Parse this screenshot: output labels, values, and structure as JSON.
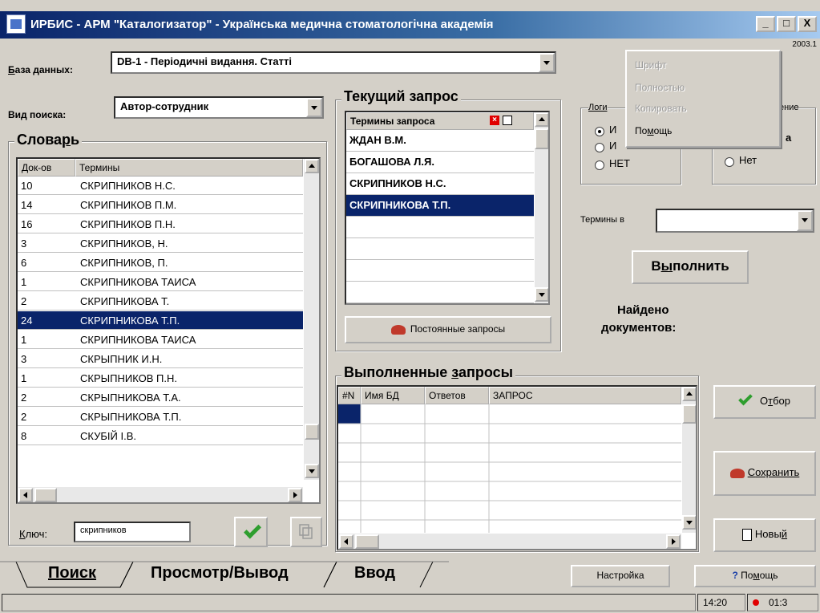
{
  "window": {
    "title": "ИРБИС - АРМ \"Каталогизатор\" - Українська медична стоматологічна академія",
    "version_text": "2003.1",
    "controls": [
      "_",
      "□",
      "X"
    ]
  },
  "database": {
    "label_prefix": "Б",
    "label_rest": "аза данных:",
    "value": "DB-1 - Періодичні видання. Статті"
  },
  "search_kind": {
    "label": "Вид поиска:",
    "value": "Автор-сотрудник"
  },
  "dictionary": {
    "title_pre": "Слова",
    "title_u": "р",
    "title_post": "ь",
    "col_docs": "Док-ов",
    "col_terms": "Термины",
    "rows": [
      {
        "docs": "10",
        "term": "СКРИПНИКОВ Н.С.",
        "selected": false
      },
      {
        "docs": "14",
        "term": "СКРИПНИКОВ П.М.",
        "selected": false
      },
      {
        "docs": "16",
        "term": "СКРИПНИКОВ П.Н.",
        "selected": false
      },
      {
        "docs": "3",
        "term": "СКРИПНИКОВ, Н.",
        "selected": false
      },
      {
        "docs": "6",
        "term": "СКРИПНИКОВ, П.",
        "selected": false
      },
      {
        "docs": "1",
        "term": "СКРИПНИКОВА  ТАИСА",
        "selected": false
      },
      {
        "docs": "2",
        "term": "СКРИПНИКОВА Т.",
        "selected": false
      },
      {
        "docs": "24",
        "term": "СКРИПНИКОВА Т.П.",
        "selected": true
      },
      {
        "docs": "1",
        "term": "СКРИПНИКОВА ТАИСА",
        "selected": false
      },
      {
        "docs": "3",
        "term": "СКРЫПНИК И.Н.",
        "selected": false
      },
      {
        "docs": "1",
        "term": "СКРЫПНИКОВ П.Н.",
        "selected": false
      },
      {
        "docs": "2",
        "term": "СКРЫПНИКОВА Т.А.",
        "selected": false
      },
      {
        "docs": "2",
        "term": "СКРЫПНИКОВА Т.П.",
        "selected": false
      },
      {
        "docs": "8",
        "term": "СКУБІЙ І.В.",
        "selected": false
      }
    ],
    "key_label_u": "К",
    "key_label_rest": "люч:",
    "key_value": "скрипников"
  },
  "current_query": {
    "title": "Текущий запрос",
    "col_terms": "Термины запроса",
    "terms": [
      {
        "text": "ЖДАН В.М.",
        "selected": false
      },
      {
        "text": "БОГАШОВА Л.Я.",
        "selected": false
      },
      {
        "text": "СКРИПНИКОВ Н.С.",
        "selected": false
      },
      {
        "text": "СКРИПНИКОВА Т.П.",
        "selected": true
      }
    ],
    "permanent_queries_label": "Постоянные запросы"
  },
  "logic": {
    "title": "Логи",
    "options": [
      "И",
      "И",
      "НЕТ"
    ],
    "selected_index": 0,
    "right_title_fragment": "ение",
    "right_option": "Нет",
    "right_option_fragment": "а"
  },
  "terms_in": {
    "label": "Термины в",
    "value": ""
  },
  "execute_button": {
    "pre": "В",
    "u": "ы",
    "post": "полнить"
  },
  "found": {
    "line1": "Найдено",
    "line2": "документов:"
  },
  "done_queries": {
    "title_pre": "Выполненные ",
    "title_u": "з",
    "title_post": "апросы",
    "columns": [
      "#N",
      "Имя БД",
      "Ответов",
      "ЗАПРОС"
    ]
  },
  "side_buttons": {
    "select_pre": "О",
    "select_u": "т",
    "select_post": "бор",
    "save_u": "С",
    "save_post": "охранить",
    "new_pre": "Новы",
    "new_u": "й"
  },
  "context_menu": {
    "items": [
      {
        "label": "Шрифт",
        "disabled": true
      },
      {
        "label": "Полностью",
        "disabled": true
      },
      {
        "label": "Копировать",
        "disabled": true
      },
      {
        "label_pre": "По",
        "label_u": "м",
        "label_post": "ощь",
        "disabled": false
      }
    ]
  },
  "tabs": [
    {
      "u": "П",
      "rest": "оиск"
    },
    {
      "u": "",
      "rest": "Просмотр/Вывод"
    },
    {
      "u": "",
      "rest": "Ввод"
    }
  ],
  "bottom_buttons": {
    "settings": "Настройка",
    "help_pre": "По",
    "help_u": "м",
    "help_post": "ощь"
  },
  "status": {
    "time": "14:20",
    "timer": "01:3"
  },
  "colors": {
    "selection": "#0a246a",
    "check_green": "#2e9e2e",
    "status_dot": "#e00000",
    "help_icon": "#1a3fa8"
  }
}
